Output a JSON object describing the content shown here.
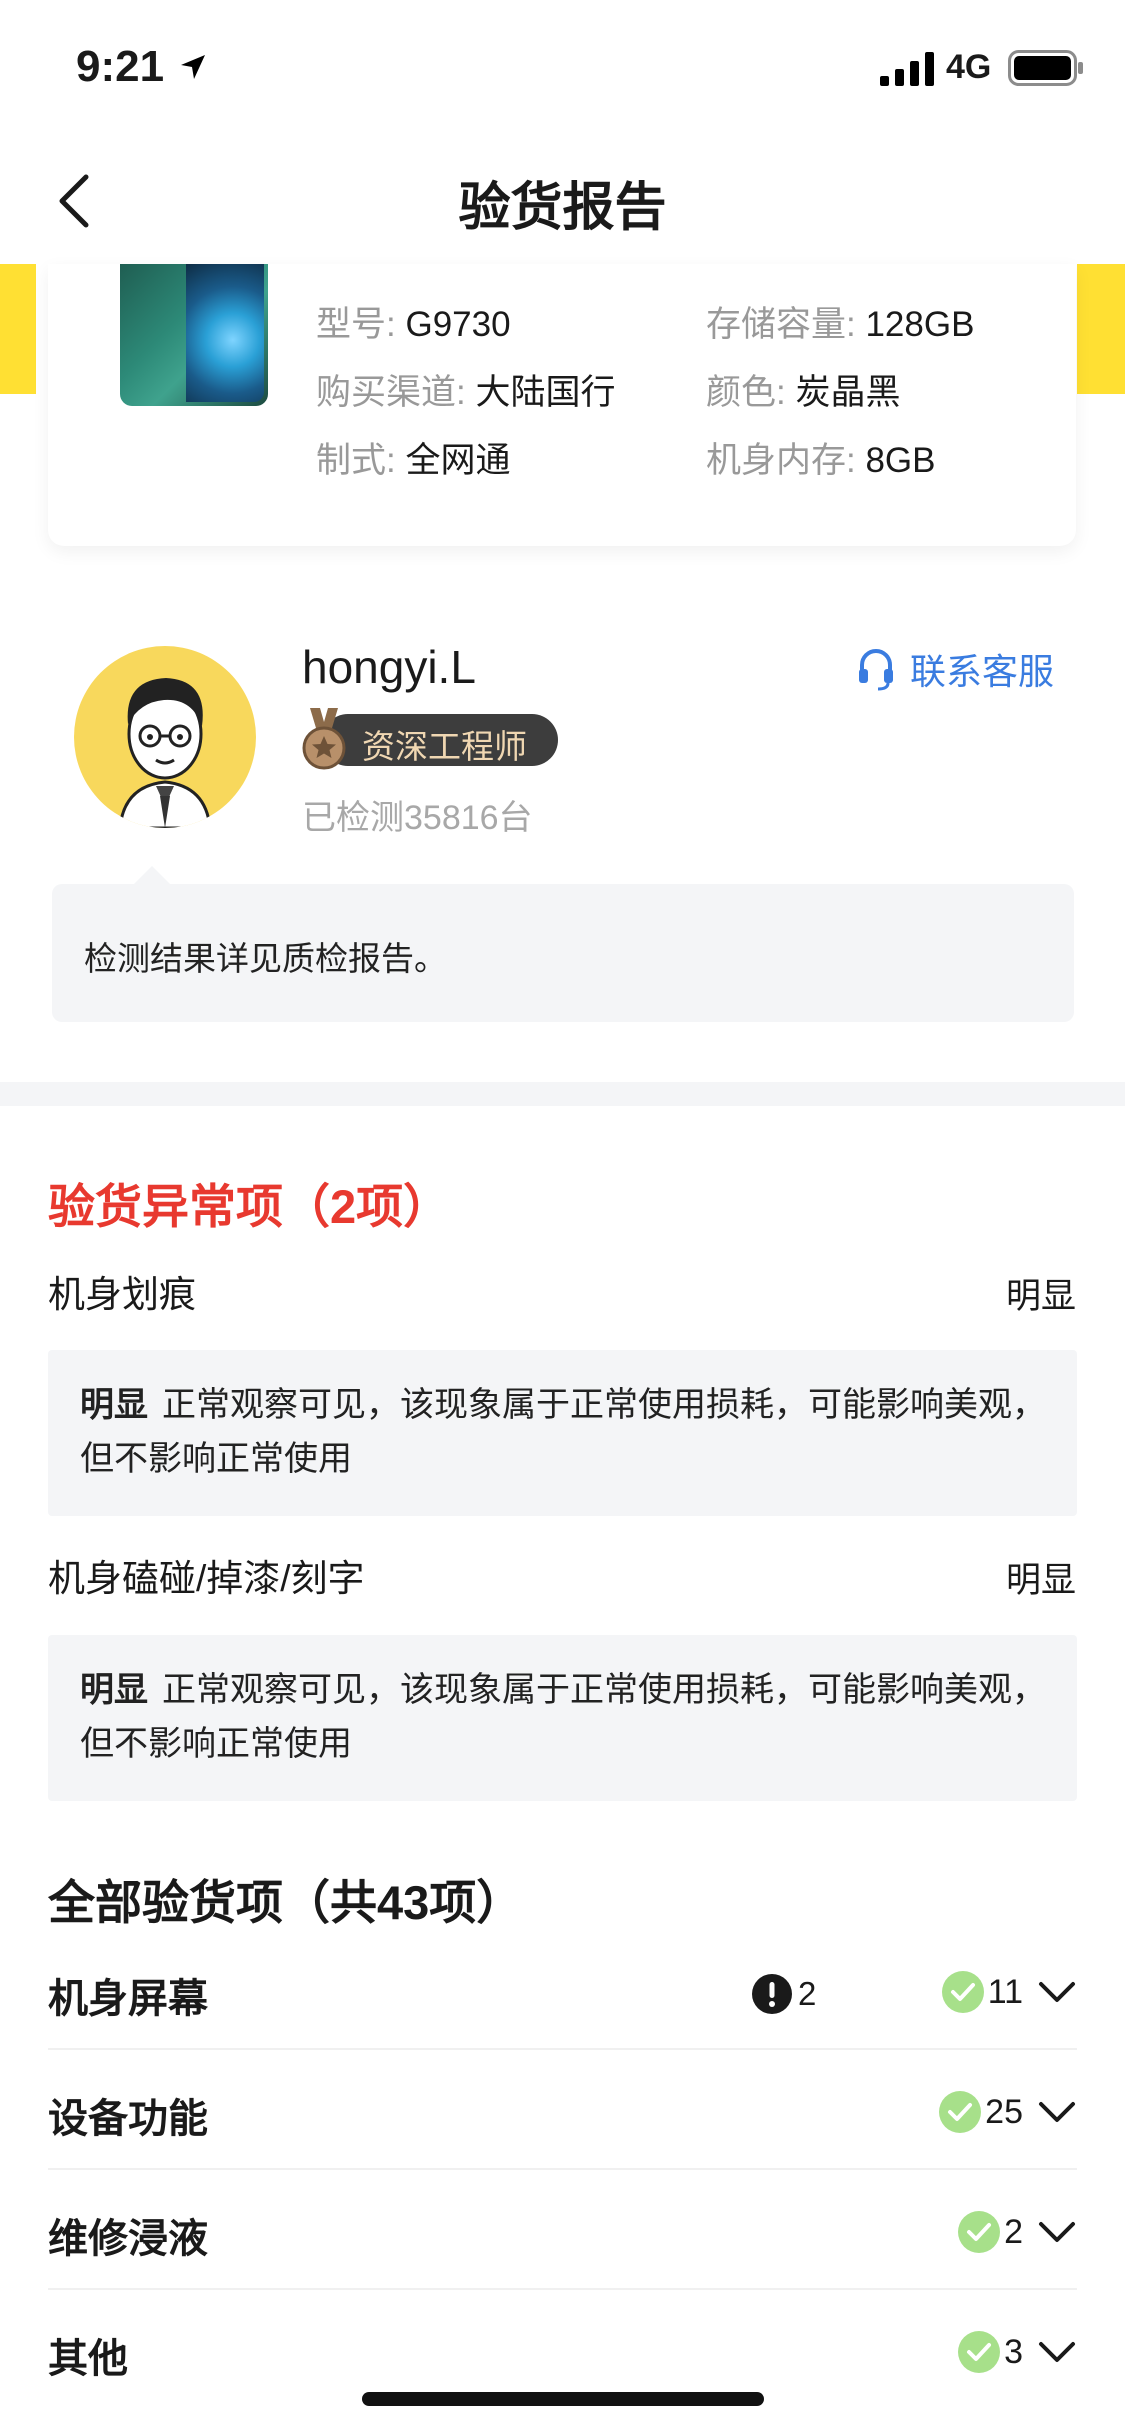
{
  "status_bar": {
    "time": "9:21",
    "network": "4G"
  },
  "nav": {
    "title": "验货报告"
  },
  "device": {
    "specs": [
      {
        "key": "型号:",
        "value": "G9730"
      },
      {
        "key": "存储容量:",
        "value": "128GB"
      },
      {
        "key": "购买渠道:",
        "value": "大陆国行"
      },
      {
        "key": "颜色:",
        "value": "炭晶黑"
      },
      {
        "key": "制式:",
        "value": "全网通"
      },
      {
        "key": "机身内存:",
        "value": "8GB"
      }
    ]
  },
  "engineer": {
    "name": "hongyi.L",
    "badge": "资深工程师",
    "count": "已检测35816台",
    "contact": "联系客服",
    "note": "检测结果详见质检报告。"
  },
  "abnormal": {
    "title": "验货异常项（2项）",
    "items": [
      {
        "name": "机身划痕",
        "level": "明显",
        "desc_level": "明显",
        "desc": "正常观察可见，该现象属于正常使用损耗，可能影响美观，但不影响正常使用"
      },
      {
        "name": "机身磕碰/掉漆/刻字",
        "level": "明显",
        "desc_level": "明显",
        "desc": "正常观察可见，该现象属于正常使用损耗，可能影响美观，但不影响正常使用"
      }
    ]
  },
  "all_items": {
    "title": "全部验货项（共43项）",
    "rows": [
      {
        "label": "机身屏幕",
        "warn": "2",
        "ok": "11"
      },
      {
        "label": "设备功能",
        "ok": "25"
      },
      {
        "label": "维修浸液",
        "ok": "2"
      },
      {
        "label": "其他",
        "ok": "3"
      }
    ]
  },
  "colors": {
    "accent_yellow": "#ffe033",
    "abnormal_red": "#e8392f",
    "link_blue": "#3a7ce0",
    "ok_green": "#a7e08a"
  }
}
